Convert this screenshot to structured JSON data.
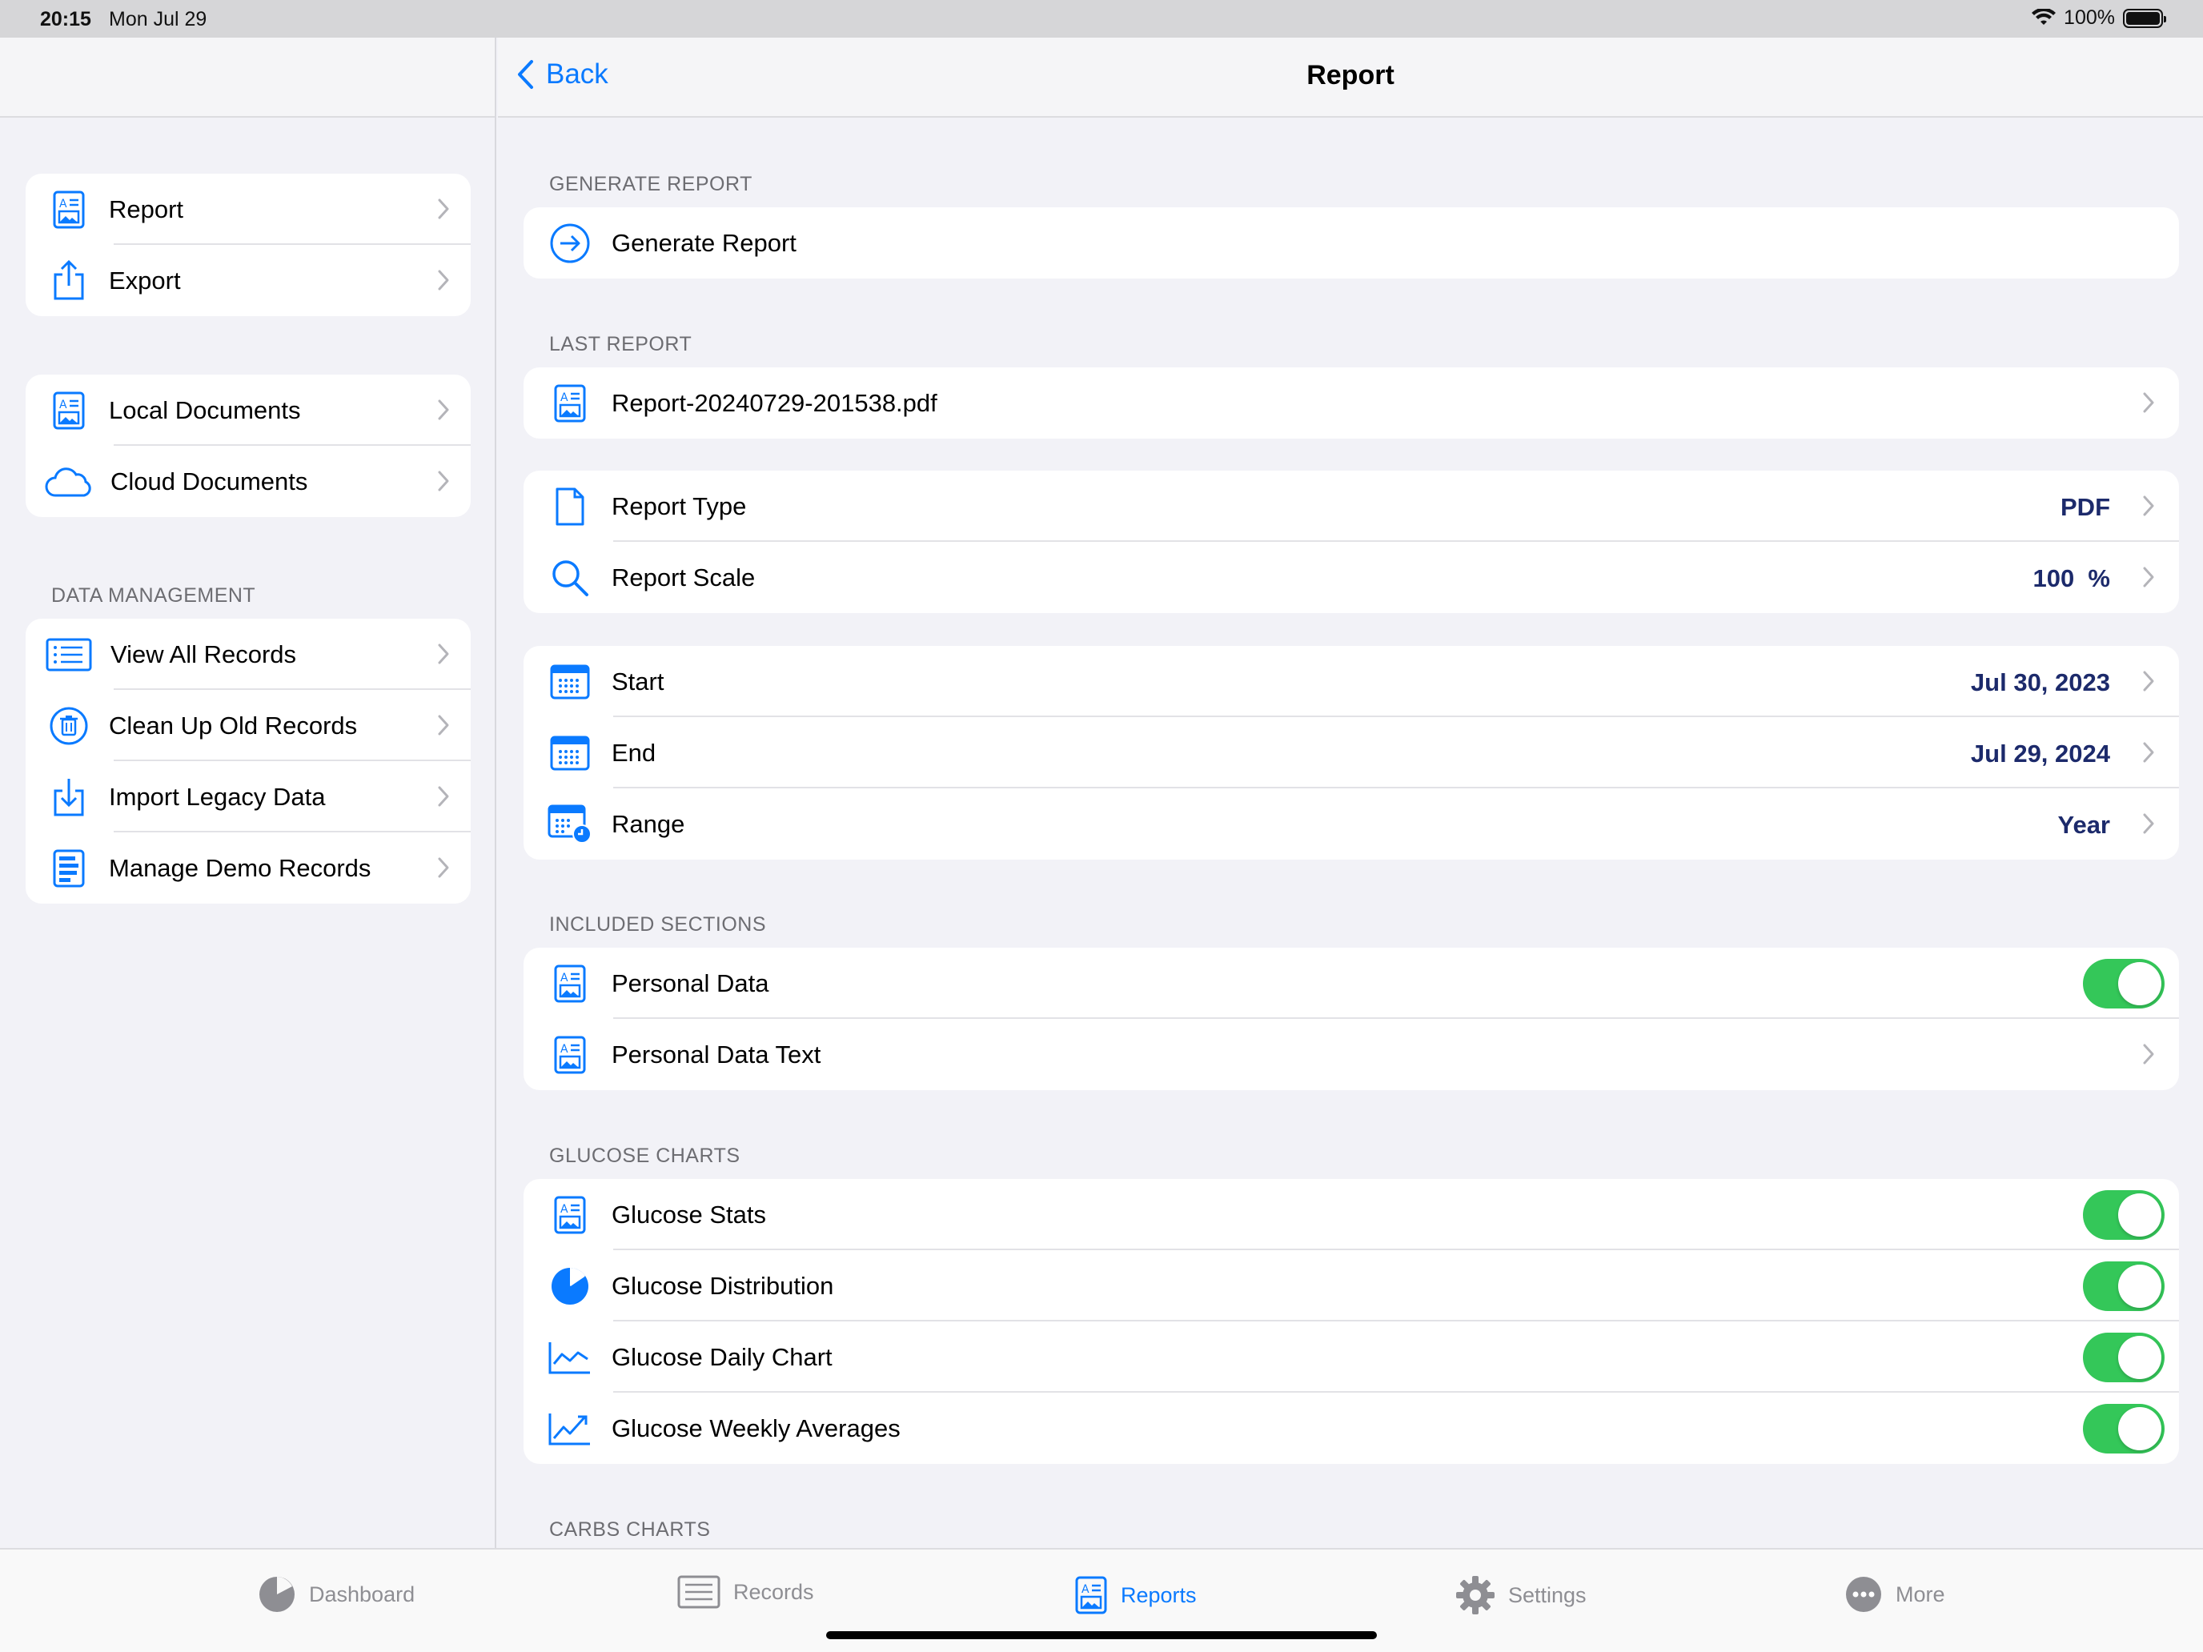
{
  "status": {
    "time": "20:15",
    "date": "Mon Jul 29",
    "battery": "100%"
  },
  "sidebar": {
    "group1": [
      {
        "label": "Report"
      },
      {
        "label": "Export"
      }
    ],
    "group2": [
      {
        "label": "Local Documents"
      },
      {
        "label": "Cloud Documents"
      }
    ],
    "data_management_title": "DATA MANAGEMENT",
    "group3": [
      {
        "label": "View All Records"
      },
      {
        "label": "Clean Up Old Records"
      },
      {
        "label": "Import Legacy Data"
      },
      {
        "label": "Manage Demo Records"
      }
    ]
  },
  "nav": {
    "back": "Back",
    "title": "Report"
  },
  "main": {
    "generate_title": "GENERATE REPORT",
    "generate_label": "Generate Report",
    "last_title": "LAST REPORT",
    "last_file": "Report-20240729-201538.pdf",
    "report_type": {
      "label": "Report Type",
      "value": "PDF"
    },
    "report_scale": {
      "label": "Report Scale",
      "value": "100  %"
    },
    "start": {
      "label": "Start",
      "value": "Jul 30, 2023"
    },
    "end": {
      "label": "End",
      "value": "Jul 29, 2024"
    },
    "range": {
      "label": "Range",
      "value": "Year"
    },
    "included_title": "INCLUDED SECTIONS",
    "personal_data": "Personal Data",
    "personal_data_text": "Personal Data Text",
    "glucose_title": "GLUCOSE CHARTS",
    "glucose_stats": "Glucose Stats",
    "glucose_distribution": "Glucose Distribution",
    "glucose_daily": "Glucose Daily Chart",
    "glucose_weekly": "Glucose Weekly Averages",
    "carbs_title": "CARBS CHARTS"
  },
  "tabs": {
    "dashboard": "Dashboard",
    "records": "Records",
    "reports": "Reports",
    "settings": "Settings",
    "more": "More"
  },
  "colors": {
    "accent": "#0a7aff",
    "toggle_on": "#34c759",
    "value_text": "#1c2a6b"
  }
}
